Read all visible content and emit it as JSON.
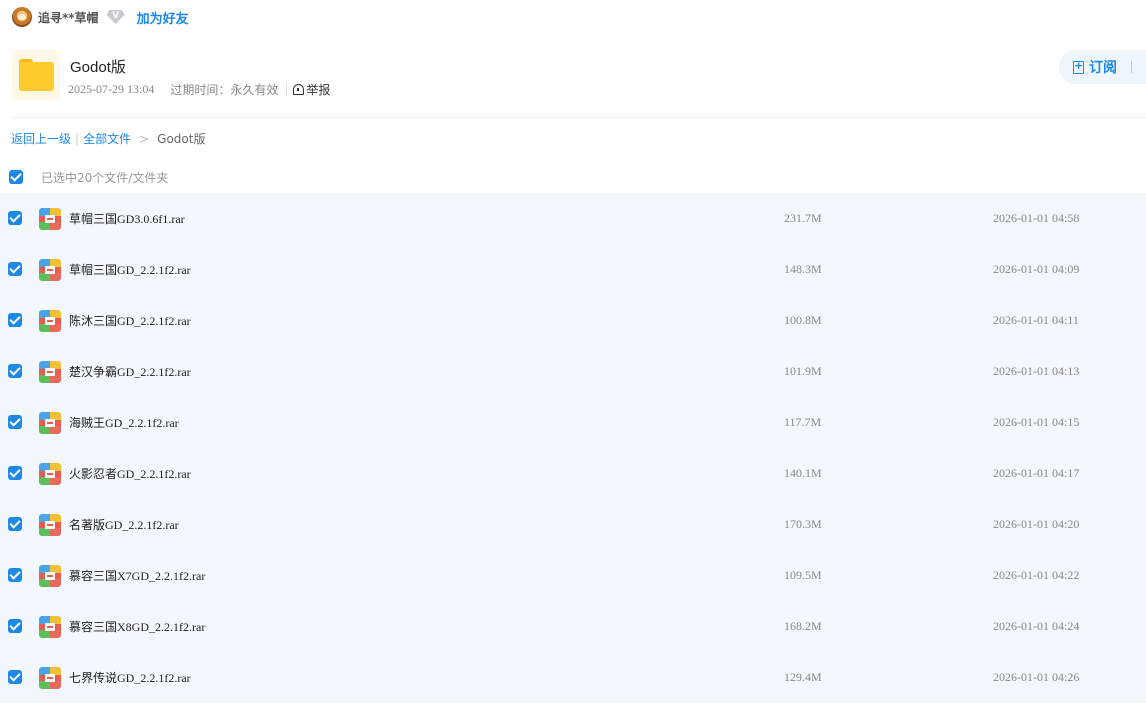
{
  "user": {
    "name": "追寻**草帽",
    "vip_badge": "V",
    "add_friend_label": "加为好友"
  },
  "share": {
    "title": "Godot版",
    "created": "2025-07-29 13:04",
    "expire_label": "过期时间：永久有效",
    "report_label": "举报",
    "subscribe_label": "订阅"
  },
  "breadcrumb": {
    "back_label": "返回上一级",
    "all_files_label": "全部文件",
    "separator": ">",
    "current": "Godot版"
  },
  "selection": {
    "label": "已选中20个文件/文件夹"
  },
  "files": [
    {
      "name": "草帽三国GD3.0.6f1.rar",
      "size": "231.7M",
      "time": "2026-01-01 04:58"
    },
    {
      "name": "草帽三国GD_2.2.1f2.rar",
      "size": "148.3M",
      "time": "2026-01-01 04:09"
    },
    {
      "name": "陈沐三国GD_2.2.1f2.rar",
      "size": "100.8M",
      "time": "2026-01-01 04:11"
    },
    {
      "name": "楚汉争霸GD_2.2.1f2.rar",
      "size": "101.9M",
      "time": "2026-01-01 04:13"
    },
    {
      "name": "海贼王GD_2.2.1f2.rar",
      "size": "117.7M",
      "time": "2026-01-01 04:15"
    },
    {
      "name": "火影忍者GD_2.2.1f2.rar",
      "size": "140.1M",
      "time": "2026-01-01 04:17"
    },
    {
      "name": "名著版GD_2.2.1f2.rar",
      "size": "170.3M",
      "time": "2026-01-01 04:20"
    },
    {
      "name": "慕容三国X7GD_2.2.1f2.rar",
      "size": "109.5M",
      "time": "2026-01-01 04:22"
    },
    {
      "name": "慕容三国X8GD_2.2.1f2.rar",
      "size": "168.2M",
      "time": "2026-01-01 04:24"
    },
    {
      "name": "七界传说GD_2.2.1f2.rar",
      "size": "129.4M",
      "time": "2026-01-01 04:26"
    }
  ],
  "colors": {
    "accent": "#1e88e5",
    "row_selected_bg": "#f2f8fd",
    "folder": "#ffcb2e"
  }
}
